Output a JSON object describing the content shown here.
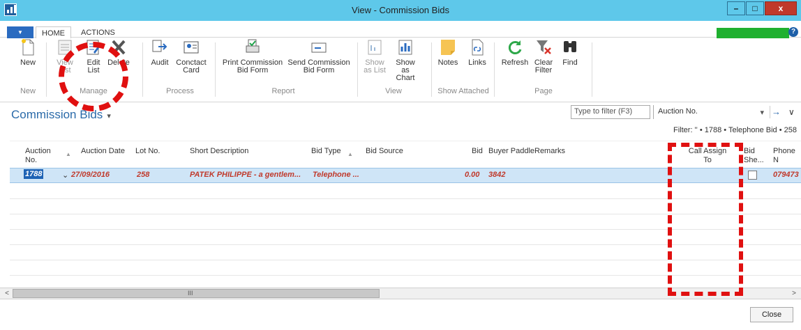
{
  "window": {
    "title": "View - Commission Bids",
    "controls": {
      "minimize": "–",
      "maximize": "□",
      "close": "x"
    }
  },
  "tabs": {
    "app_menu": "▼",
    "home": "HOME",
    "actions": "ACTIONS",
    "help": "?"
  },
  "progress": {
    "value": 1.0,
    "color": "#1fb02f"
  },
  "ribbon": {
    "groups": {
      "new": {
        "label": "New",
        "buttons": {
          "new": "New"
        }
      },
      "manage": {
        "label": "Manage",
        "buttons": {
          "view_list": [
            "View",
            "List"
          ],
          "edit_list": [
            "Edit",
            "List"
          ],
          "delete": "Delete"
        }
      },
      "process": {
        "label": "Process",
        "buttons": {
          "audit": "Audit",
          "contact_card": [
            "Conctact",
            "Card"
          ]
        }
      },
      "report": {
        "label": "Report",
        "buttons": {
          "print": [
            "Print Commission",
            "Bid Form"
          ],
          "send": [
            "Send Commission",
            "Bid Form"
          ]
        }
      },
      "view": {
        "label": "View",
        "buttons": {
          "show_list": [
            "Show",
            "as List"
          ],
          "show_chart": [
            "Show as",
            "Chart"
          ]
        }
      },
      "show_attached": {
        "label": "Show Attached",
        "buttons": {
          "notes": "Notes",
          "links": "Links"
        }
      },
      "page": {
        "label": "Page",
        "buttons": {
          "refresh": "Refresh",
          "clear_filter": [
            "Clear",
            "Filter"
          ],
          "find": "Find"
        }
      }
    }
  },
  "page": {
    "title": "Commission Bids",
    "title_caret": "▾",
    "filter_placeholder": "Type to filter (F3)",
    "filter_field": "Auction No.",
    "filter_summary": "Filter: '' • 1788 • Telephone Bid • 258",
    "go_icon": "→",
    "collapse_icon": "∨"
  },
  "grid": {
    "headers": {
      "auction_no": [
        "Auction",
        "No."
      ],
      "auction_date": "Auction Date",
      "lot_no": "Lot No.",
      "short_description": "Short Description",
      "bid_type": "Bid Type",
      "bid_source": "Bid Source",
      "bid": "Bid",
      "buyer_paddle": "Buyer Paddle",
      "remarks": "Remarks",
      "call_assign_to": [
        "Call Assign",
        "To"
      ],
      "bid_sheet": [
        "Bid",
        "She..."
      ],
      "phone_no": "Phone N"
    },
    "rows": [
      {
        "auction_no": "1788",
        "auction_date": "27/09/2016",
        "lot_no": "258",
        "short_description": "PATEK PHILIPPE - a gentlem...",
        "bid_type": "Telephone ...",
        "bid_source": "",
        "bid": "0.00",
        "buyer_paddle": "3842",
        "remarks": "",
        "call_assign_to": "",
        "bid_sheet": false,
        "phone_no": "079473"
      }
    ]
  },
  "scrollbar": {
    "left": "<",
    "right": ">",
    "grip": "III"
  },
  "footer": {
    "close_label": "Close"
  }
}
